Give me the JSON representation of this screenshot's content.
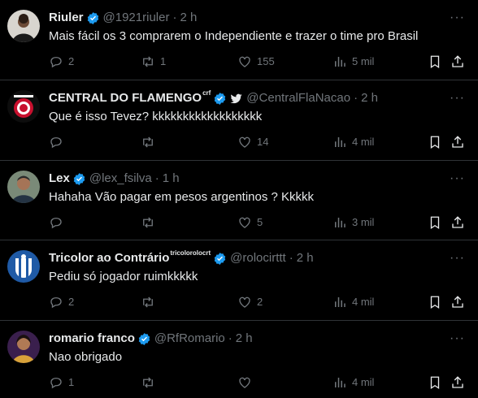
{
  "tweets": [
    {
      "name": "Riuler",
      "handle": "@1921riuler",
      "time": "2 h",
      "text": "Mais fácil os 3 comprarem o Independiente e trazer o time pro Brasil",
      "replies": "2",
      "retweets": "1",
      "likes": "155",
      "views": "5 mil"
    },
    {
      "name": "CENTRAL DO FLAMENGO",
      "affiliate": "crf",
      "handle": "@CentralFlaNacao",
      "time": "2 h",
      "text": "Que é isso Tevez? kkkkkkkkkkkkkkkkkk",
      "replies": "",
      "retweets": "",
      "likes": "14",
      "views": "4 mil"
    },
    {
      "name": "Lex",
      "handle": "@lex_fsilva",
      "time": "1 h",
      "text": "Hahaha Vão pagar em pesos argentinos ? Kkkkk",
      "replies": "",
      "retweets": "",
      "likes": "5",
      "views": "3 mil"
    },
    {
      "name": "Tricolor ao Contrário",
      "affiliate": "tricolorolocrt",
      "handle": "@rolocirttt",
      "time": "2 h",
      "text": "Pediu só jogador ruimkkkkk",
      "replies": "2",
      "retweets": "",
      "likes": "2",
      "views": "4 mil"
    },
    {
      "name": "romario franco",
      "handle": "@RfRomario",
      "time": "2 h",
      "text": "Nao obrigado",
      "replies": "1",
      "retweets": "",
      "likes": "",
      "views": "4 mil"
    }
  ],
  "separator": "·",
  "more_label": "···",
  "icons": {
    "verified": "verified-badge-icon",
    "reply": "reply-icon",
    "retweet": "retweet-icon",
    "like": "heart-icon",
    "views": "views-chart-icon",
    "bookmark": "bookmark-icon",
    "share": "share-icon"
  },
  "colors": {
    "background": "#000000",
    "text": "#e7e9ea",
    "muted": "#71767b",
    "verified": "#1d9bf0",
    "divider": "#2f3336"
  }
}
